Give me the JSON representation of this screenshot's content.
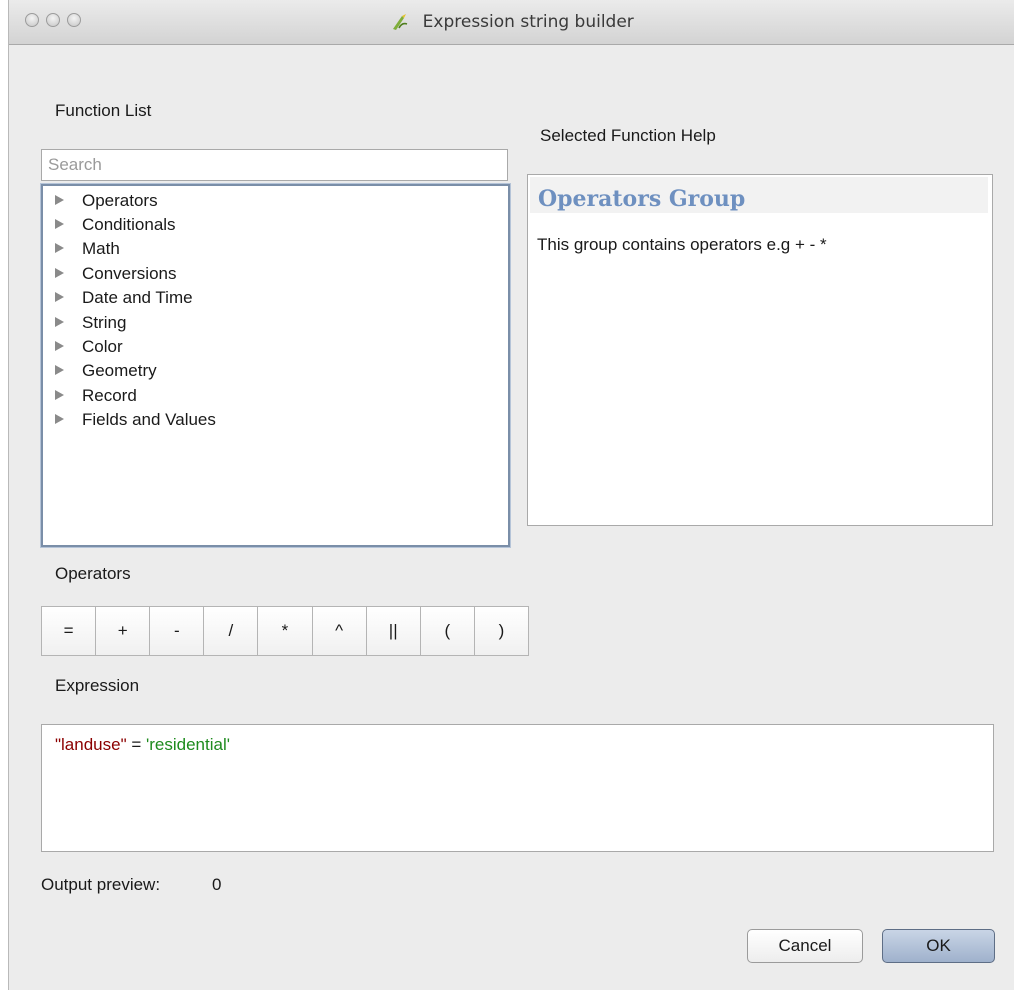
{
  "window": {
    "title": "Expression string builder",
    "title_icon": "qgis-expression-icon"
  },
  "function_list": {
    "label": "Function List",
    "search_placeholder": "Search",
    "items": [
      {
        "label": "Operators"
      },
      {
        "label": "Conditionals"
      },
      {
        "label": "Math"
      },
      {
        "label": "Conversions"
      },
      {
        "label": "Date and Time"
      },
      {
        "label": "String"
      },
      {
        "label": "Color"
      },
      {
        "label": "Geometry"
      },
      {
        "label": "Record"
      },
      {
        "label": "Fields and Values"
      }
    ]
  },
  "help": {
    "label": "Selected Function Help",
    "title": "Operators Group",
    "body": "This group contains operators e.g + - *",
    "title_color": "#6e90c0"
  },
  "operators": {
    "label": "Operators",
    "buttons": [
      "=",
      "+",
      "-",
      "/",
      "*",
      "^",
      "||",
      "(",
      ")"
    ]
  },
  "expression": {
    "label": "Expression",
    "field": "\"landuse\"",
    "operator": " = ",
    "value": "'residential'",
    "field_color": "#8b0000",
    "value_color": "#1e8b1e"
  },
  "output_preview": {
    "label": "Output preview:",
    "value": "0"
  },
  "buttons": {
    "cancel": "Cancel",
    "ok": "OK"
  }
}
